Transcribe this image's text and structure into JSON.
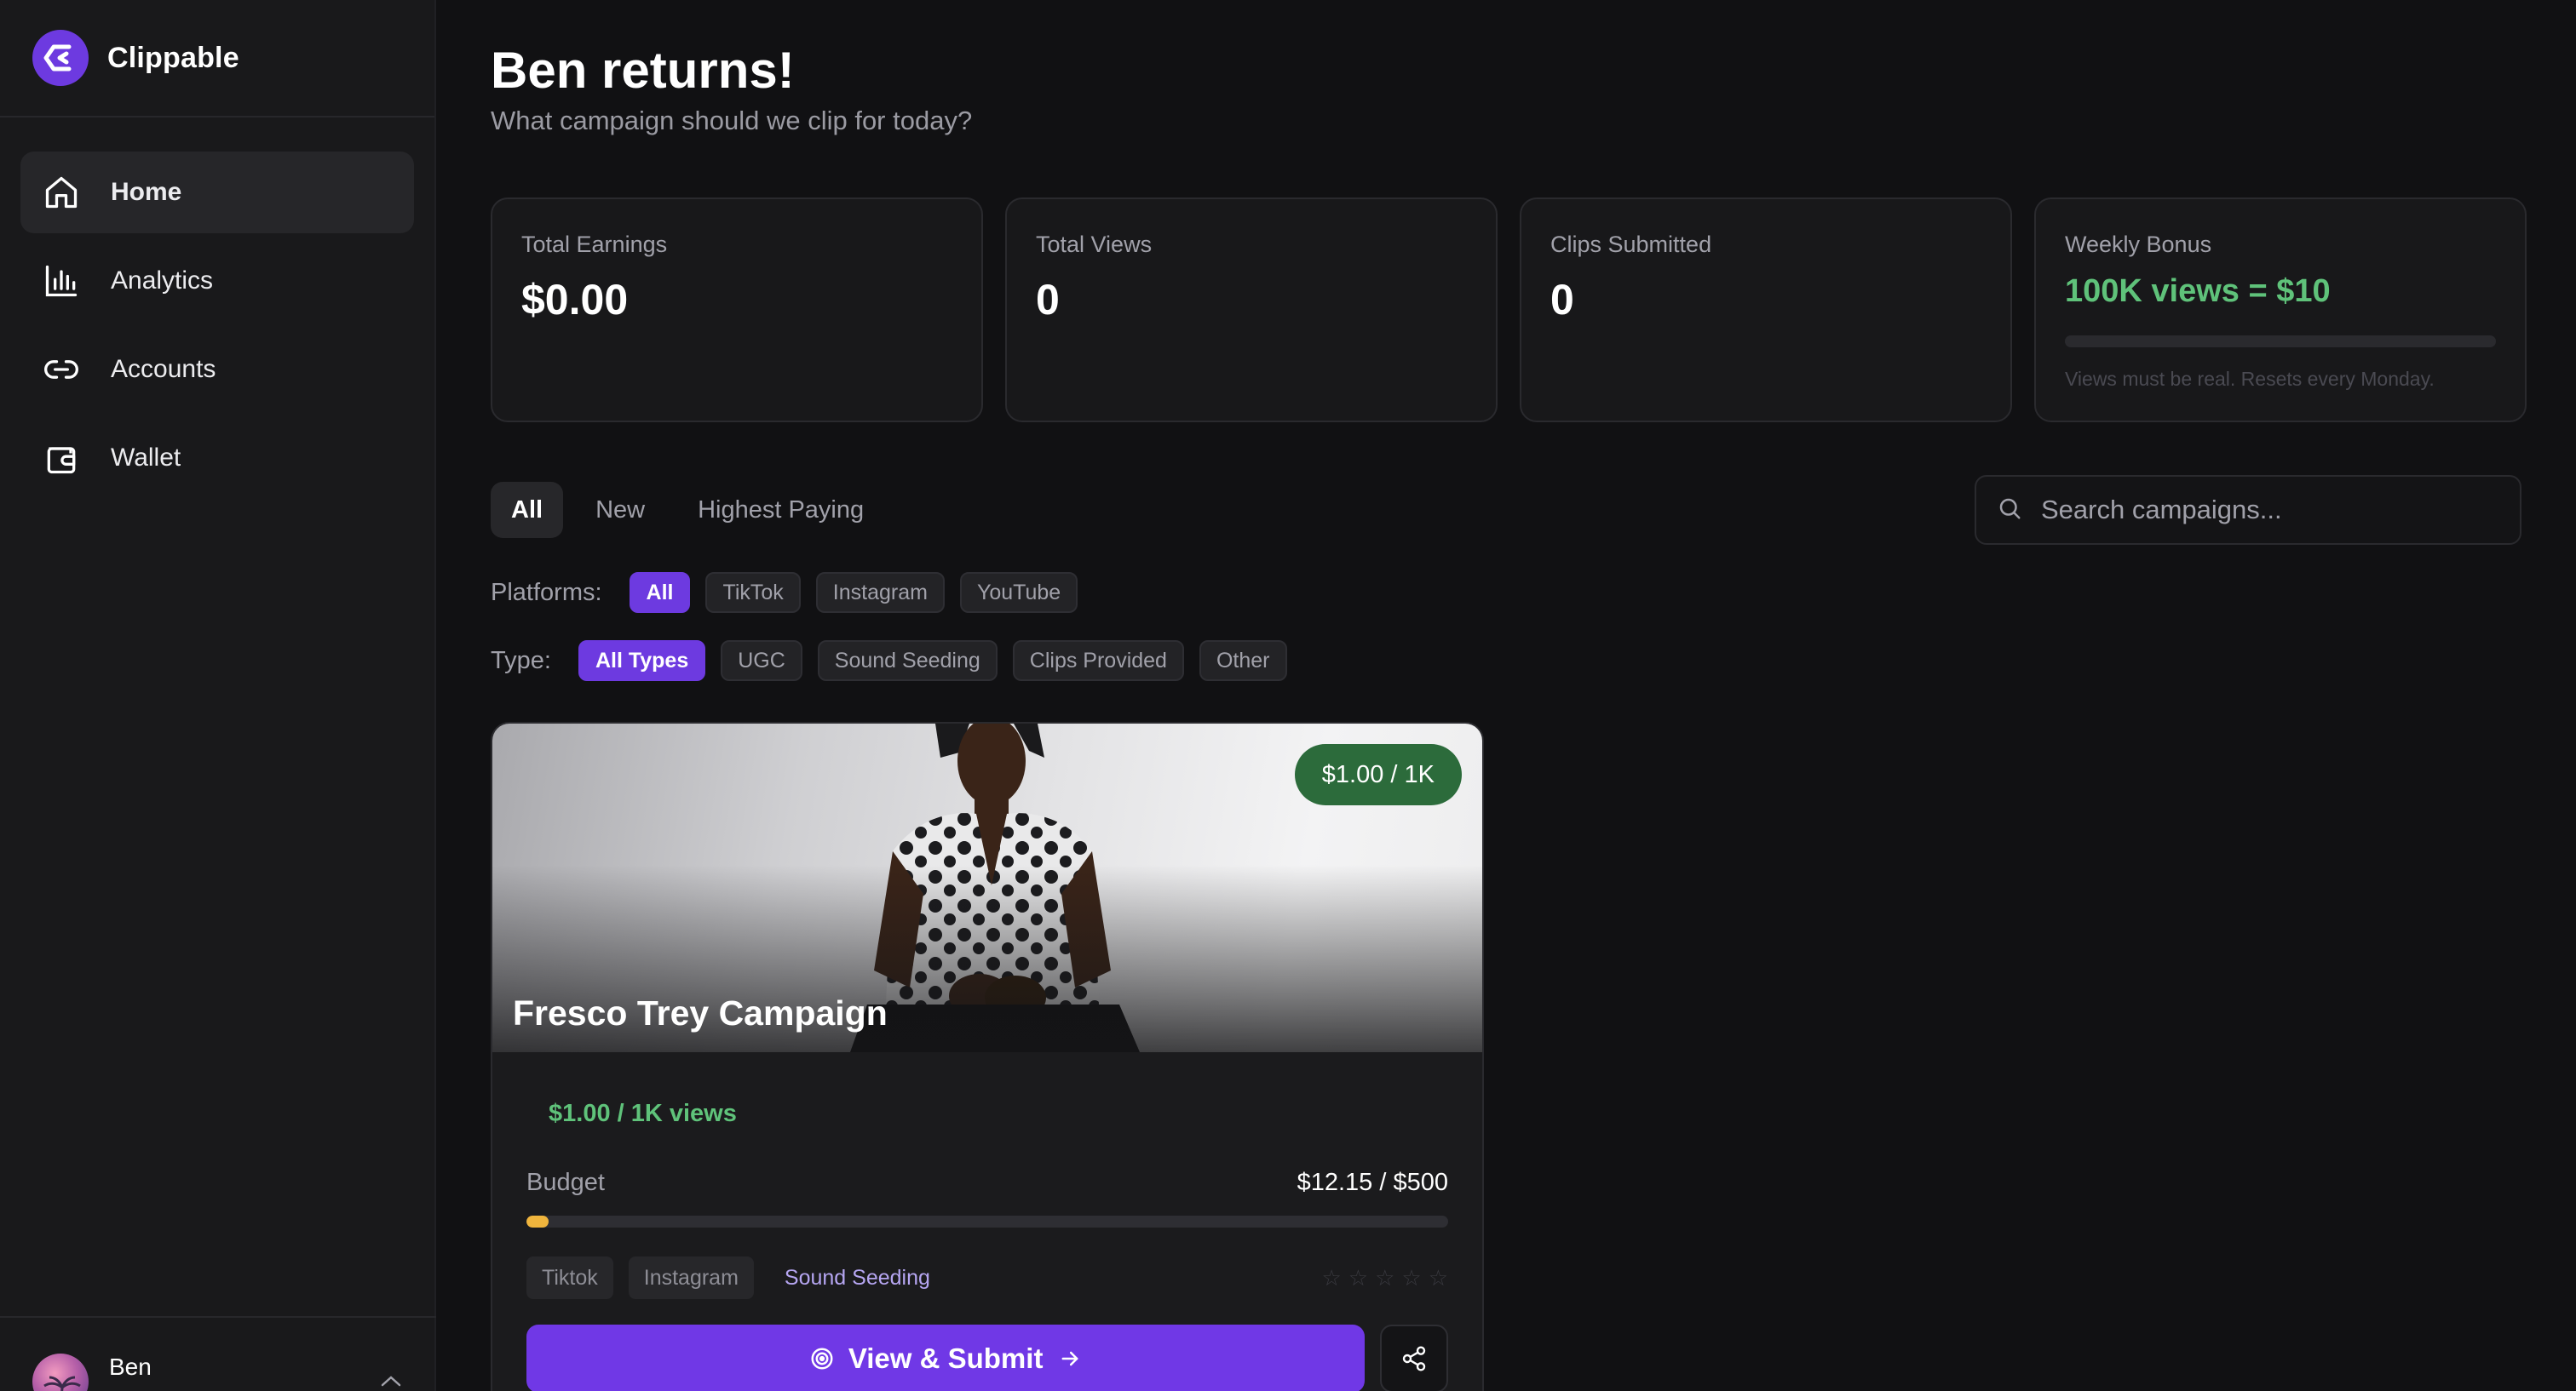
{
  "app": {
    "name": "Clippable"
  },
  "sidebar": {
    "items": [
      {
        "label": "Home",
        "icon": "home-icon",
        "active": true
      },
      {
        "label": "Analytics",
        "icon": "bar-chart-icon",
        "active": false
      },
      {
        "label": "Accounts",
        "icon": "link-icon",
        "active": false
      },
      {
        "label": "Wallet",
        "icon": "wallet-icon",
        "active": false
      }
    ],
    "user": {
      "name": "Ben"
    }
  },
  "header": {
    "greeting": "Ben returns!",
    "subtitle": "What campaign should we clip for today?"
  },
  "stats": {
    "earnings": {
      "label": "Total Earnings",
      "value": "$0.00"
    },
    "views": {
      "label": "Total Views",
      "value": "0"
    },
    "clips": {
      "label": "Clips Submitted",
      "value": "0"
    },
    "bonus": {
      "label": "Weekly Bonus",
      "value": "100K views = $10",
      "progress": 0,
      "note": "Views must be real. Resets every Monday."
    }
  },
  "tabs": [
    {
      "label": "All",
      "active": true
    },
    {
      "label": "New",
      "active": false
    },
    {
      "label": "Highest Paying",
      "active": false
    }
  ],
  "search": {
    "placeholder": "Search campaigns..."
  },
  "filters": {
    "platforms": {
      "label": "Platforms:",
      "options": [
        "All",
        "TikTok",
        "Instagram",
        "YouTube"
      ],
      "selected": "All"
    },
    "type": {
      "label": "Type:",
      "options": [
        "All Types",
        "UGC",
        "Sound Seeding",
        "Clips Provided",
        "Other"
      ],
      "selected": "All Types"
    }
  },
  "campaign": {
    "title": "Fresco Trey Campaign",
    "badge": "$1.00 / 1K",
    "rate": "$1.00 / 1K views",
    "budget_label": "Budget",
    "budget_value": "$12.15 / $500",
    "budget_spent": 12.15,
    "budget_total": 500,
    "platform_tags": [
      "Tiktok",
      "Instagram"
    ],
    "type_tag": "Sound Seeding",
    "rating": 0,
    "submit_label": "View & Submit"
  },
  "colors": {
    "accent": "#6d3ae0",
    "success": "#5fc27a",
    "badge_green": "#2c6b3b",
    "budget_fill": "#f0b53d"
  }
}
